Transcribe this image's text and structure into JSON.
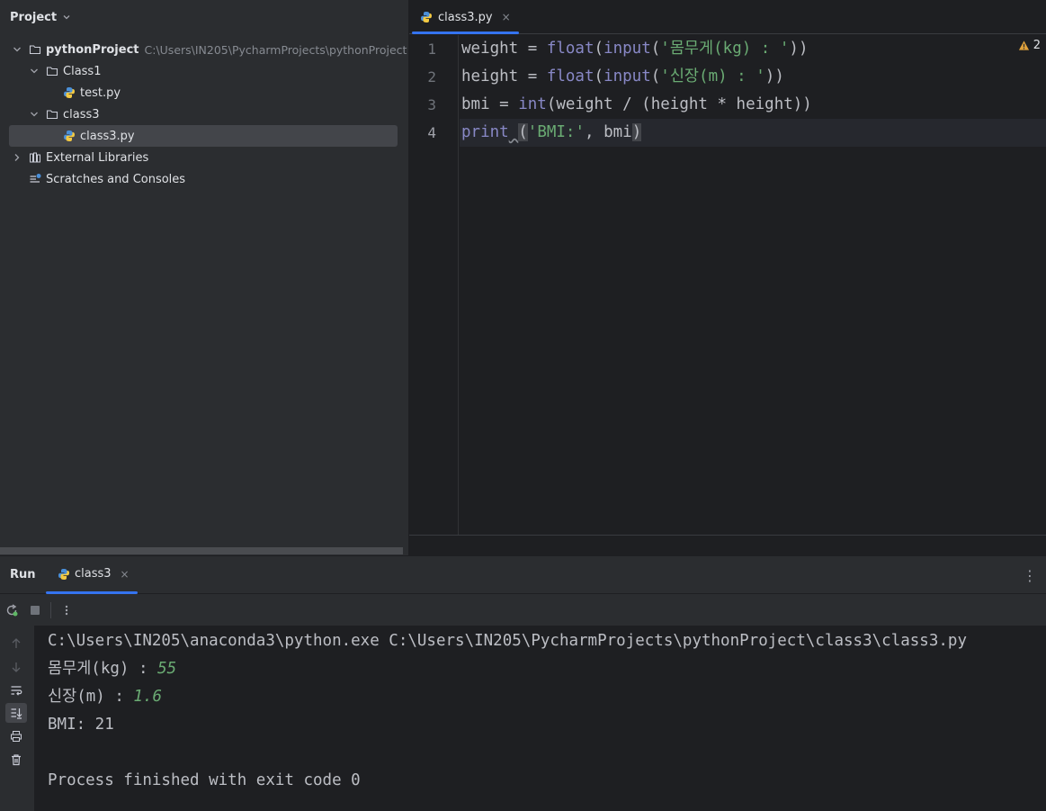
{
  "project": {
    "header": "Project",
    "root_name": "pythonProject",
    "root_path": "C:\\Users\\IN205\\PycharmProjects\\pythonProject",
    "folder_class1": "Class1",
    "file_test": "test.py",
    "folder_class3": "class3",
    "file_class3": "class3.py",
    "external_libraries": "External Libraries",
    "scratches": "Scratches and Consoles"
  },
  "editor": {
    "tab_label": "class3.py",
    "tab_close": "×",
    "warning_count": "2",
    "line_numbers": [
      "1",
      "2",
      "3",
      "4"
    ],
    "code": {
      "l1_a": "weight = ",
      "l1_fn1": "float",
      "l1_b": "(",
      "l1_fn2": "input",
      "l1_c": "(",
      "l1_str": "'몸무게(kg) : '",
      "l1_d": "))",
      "l2_a": "height = ",
      "l2_fn1": "float",
      "l2_b": "(",
      "l2_fn2": "input",
      "l2_c": "(",
      "l2_str": "'신장(m) : '",
      "l2_d": "))",
      "l3_a": "bmi = ",
      "l3_fn": "int",
      "l3_b": "(weight / (height * height))",
      "l4_fn": "print",
      "l4_sp": " ",
      "l4_open": "(",
      "l4_str": "'BMI:'",
      "l4_rest": ", bmi",
      "l4_close": ")"
    }
  },
  "run": {
    "title": "Run",
    "tab_label": "class3",
    "tab_close": "×",
    "more": "⋮",
    "console": {
      "cmd": "C:\\Users\\IN205\\anaconda3\\python.exe C:\\Users\\IN205\\PycharmProjects\\pythonProject\\class3\\class3.py",
      "prompt1": "몸무게(kg) : ",
      "input1": "55",
      "prompt2": "신장(m) : ",
      "input2": "1.6",
      "result": "BMI: 21",
      "exit": "Process finished with exit code 0"
    }
  },
  "colors": {
    "accent": "#3574f0",
    "string": "#6aab73",
    "builtin": "#8888c6"
  }
}
